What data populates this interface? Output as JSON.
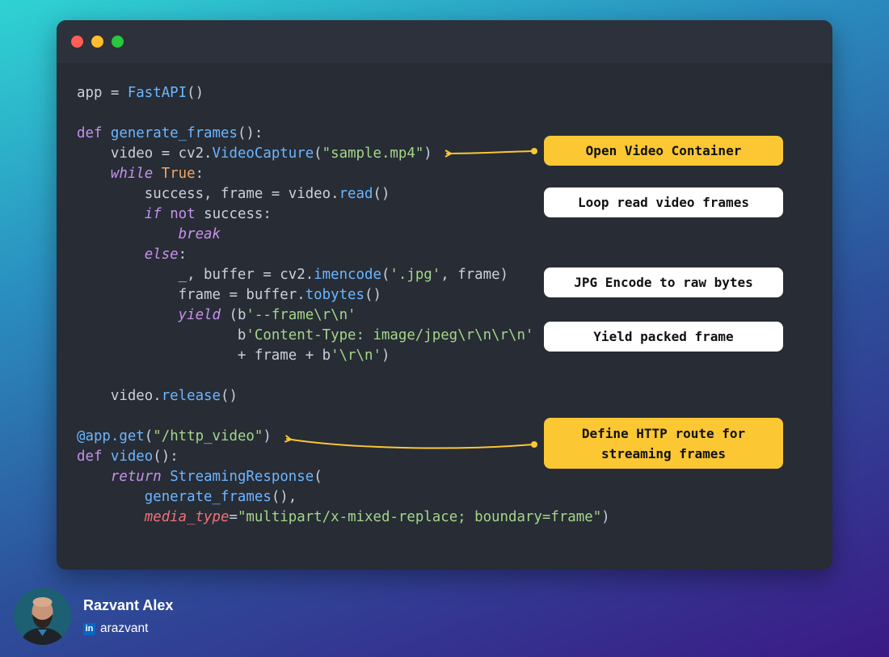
{
  "code_lines": [
    [
      {
        "t": "app = "
      },
      {
        "t": "FastAPI",
        "c": "fn"
      },
      {
        "t": "()"
      }
    ],
    [],
    [
      {
        "t": "def ",
        "c": "kw"
      },
      {
        "t": "generate_frames",
        "c": "fn"
      },
      {
        "t": "():"
      }
    ],
    [
      {
        "t": "    video = cv2."
      },
      {
        "t": "VideoCapture",
        "c": "fn"
      },
      {
        "t": "("
      },
      {
        "t": "\"sample.mp4\"",
        "c": "str"
      },
      {
        "t": ")"
      }
    ],
    [
      {
        "t": "    "
      },
      {
        "t": "while",
        "c": "kwi"
      },
      {
        "t": " "
      },
      {
        "t": "True",
        "c": "const"
      },
      {
        "t": ":"
      }
    ],
    [
      {
        "t": "        success, frame = video."
      },
      {
        "t": "read",
        "c": "fn"
      },
      {
        "t": "()"
      }
    ],
    [
      {
        "t": "        "
      },
      {
        "t": "if",
        "c": "kwi"
      },
      {
        "t": " "
      },
      {
        "t": "not",
        "c": "kw"
      },
      {
        "t": " success:"
      }
    ],
    [
      {
        "t": "            "
      },
      {
        "t": "break",
        "c": "kwi"
      }
    ],
    [
      {
        "t": "        "
      },
      {
        "t": "else",
        "c": "kwi"
      },
      {
        "t": ":"
      }
    ],
    [
      {
        "t": "            _, buffer = cv2."
      },
      {
        "t": "imencode",
        "c": "fn"
      },
      {
        "t": "("
      },
      {
        "t": "'.jpg'",
        "c": "str"
      },
      {
        "t": ", frame)"
      }
    ],
    [
      {
        "t": "            frame = buffer."
      },
      {
        "t": "tobytes",
        "c": "fn"
      },
      {
        "t": "()"
      }
    ],
    [
      {
        "t": "            "
      },
      {
        "t": "yield",
        "c": "kwi"
      },
      {
        "t": " (b"
      },
      {
        "t": "'--frame\\r\\n'",
        "c": "str"
      }
    ],
    [
      {
        "t": "                   b"
      },
      {
        "t": "'Content-Type: image/jpeg\\r\\n\\r\\n'",
        "c": "str"
      }
    ],
    [
      {
        "t": "                   + frame + b"
      },
      {
        "t": "'\\r\\n'",
        "c": "str"
      },
      {
        "t": ")"
      }
    ],
    [],
    [
      {
        "t": "    video."
      },
      {
        "t": "release",
        "c": "fn"
      },
      {
        "t": "()"
      }
    ],
    [],
    [
      {
        "t": "@app.get",
        "c": "fn"
      },
      {
        "t": "("
      },
      {
        "t": "\"/http_video\"",
        "c": "str"
      },
      {
        "t": ")"
      }
    ],
    [
      {
        "t": "def ",
        "c": "kw"
      },
      {
        "t": "video",
        "c": "fn"
      },
      {
        "t": "():"
      }
    ],
    [
      {
        "t": "    "
      },
      {
        "t": "return",
        "c": "kwi"
      },
      {
        "t": " "
      },
      {
        "t": "StreamingResponse",
        "c": "fn"
      },
      {
        "t": "("
      }
    ],
    [
      {
        "t": "        "
      },
      {
        "t": "generate_frames",
        "c": "fn"
      },
      {
        "t": "(),"
      }
    ],
    [
      {
        "t": "        "
      },
      {
        "t": "media_type",
        "c": "param"
      },
      {
        "t": "="
      },
      {
        "t": "\"multipart/x-mixed-replace; boundary=frame\"",
        "c": "str"
      },
      {
        "t": ")"
      }
    ]
  ],
  "callouts": {
    "open_video": "Open Video Container",
    "loop_read": "Loop read video frames",
    "jpg_encode": "JPG Encode to raw bytes",
    "yield_frame": "Yield packed frame",
    "define_route_line1": "Define HTTP route for",
    "define_route_line2": "streaming frames"
  },
  "author": {
    "name": "Razvant Alex",
    "handle": "arazvant",
    "linkedin_icon": "in"
  },
  "colors": {
    "callout_accent": "#fbc733",
    "window_bg": "#272c35",
    "keyword": "#c792ea",
    "function": "#6cb6ff",
    "string": "#a5d68a"
  }
}
